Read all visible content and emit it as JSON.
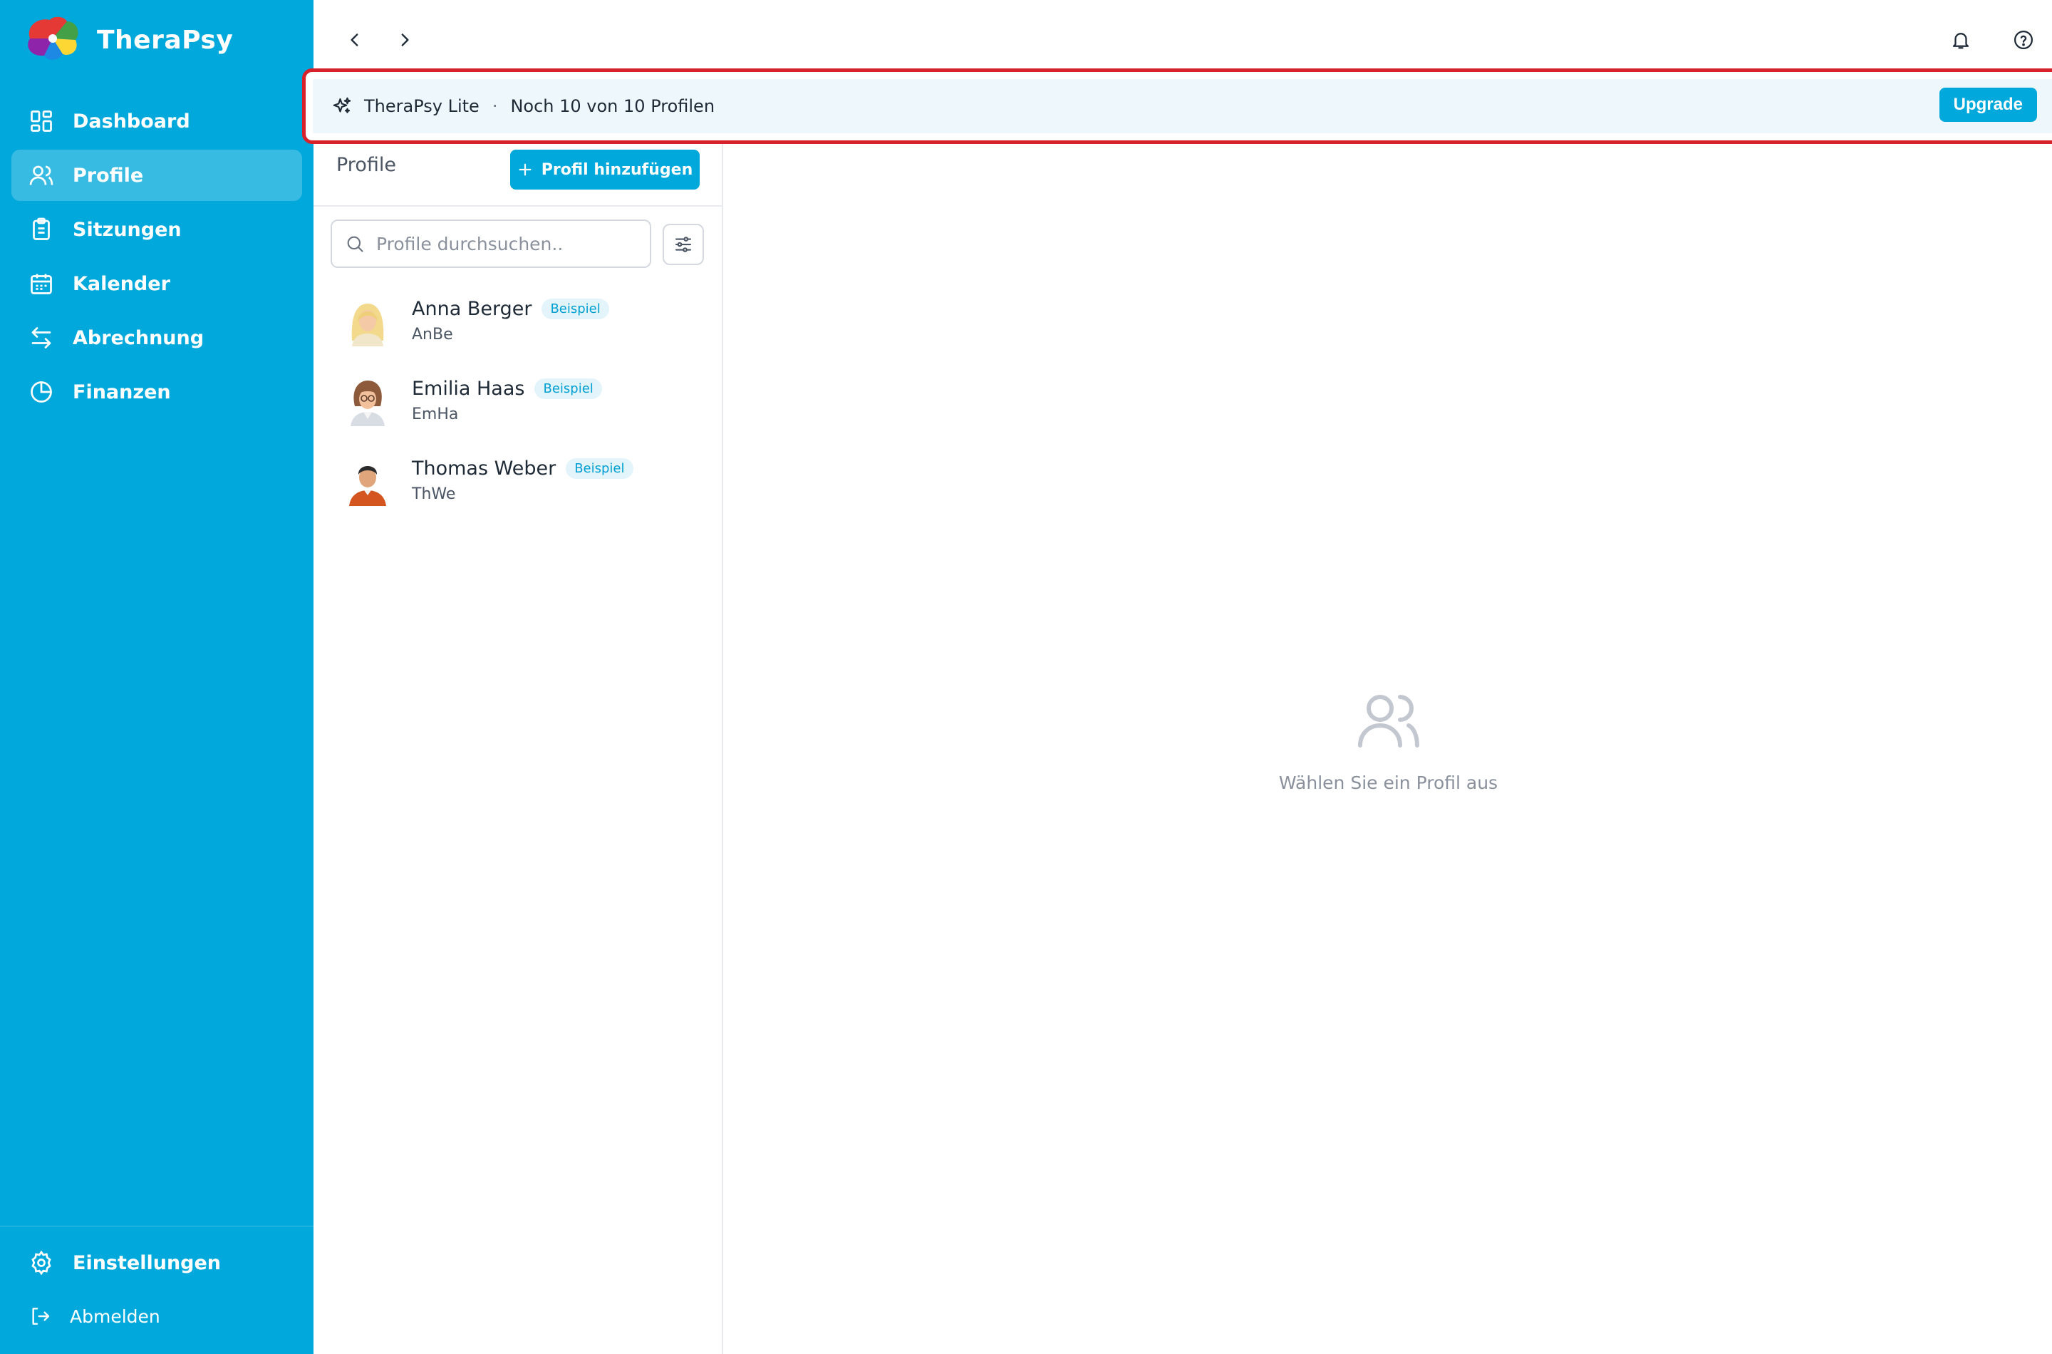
{
  "app": {
    "name": "TheraPsy"
  },
  "sidebar": {
    "items": [
      {
        "label": "Dashboard",
        "icon": "dashboard-icon",
        "active": false
      },
      {
        "label": "Profile",
        "icon": "users-icon",
        "active": true
      },
      {
        "label": "Sitzungen",
        "icon": "clipboard-icon",
        "active": false
      },
      {
        "label": "Kalender",
        "icon": "calendar-icon",
        "active": false
      },
      {
        "label": "Abrechnung",
        "icon": "arrows-exchange-icon",
        "active": false
      },
      {
        "label": "Finanzen",
        "icon": "pie-chart-icon",
        "active": false
      }
    ],
    "settings_label": "Einstellungen",
    "logout_label": "Abmelden"
  },
  "banner": {
    "plan": "TheraPsy Lite",
    "separator": "·",
    "quota": "Noch 10 von 10 Profilen",
    "upgrade_label": "Upgrade"
  },
  "list": {
    "title": "Profile",
    "add_label": "Profil hinzufügen",
    "search_placeholder": "Profile durchsuchen..",
    "profiles": [
      {
        "name": "Anna Berger",
        "code": "AnBe",
        "badge": "Beispiel"
      },
      {
        "name": "Emilia Haas",
        "code": "EmHa",
        "badge": "Beispiel"
      },
      {
        "name": "Thomas Weber",
        "code": "ThWe",
        "badge": "Beispiel"
      }
    ]
  },
  "detail": {
    "empty_text": "Wählen Sie ein Profil aus"
  },
  "colors": {
    "primary": "#00a8dc",
    "highlight_border": "#d7222c",
    "banner_bg": "#eef8fc"
  }
}
